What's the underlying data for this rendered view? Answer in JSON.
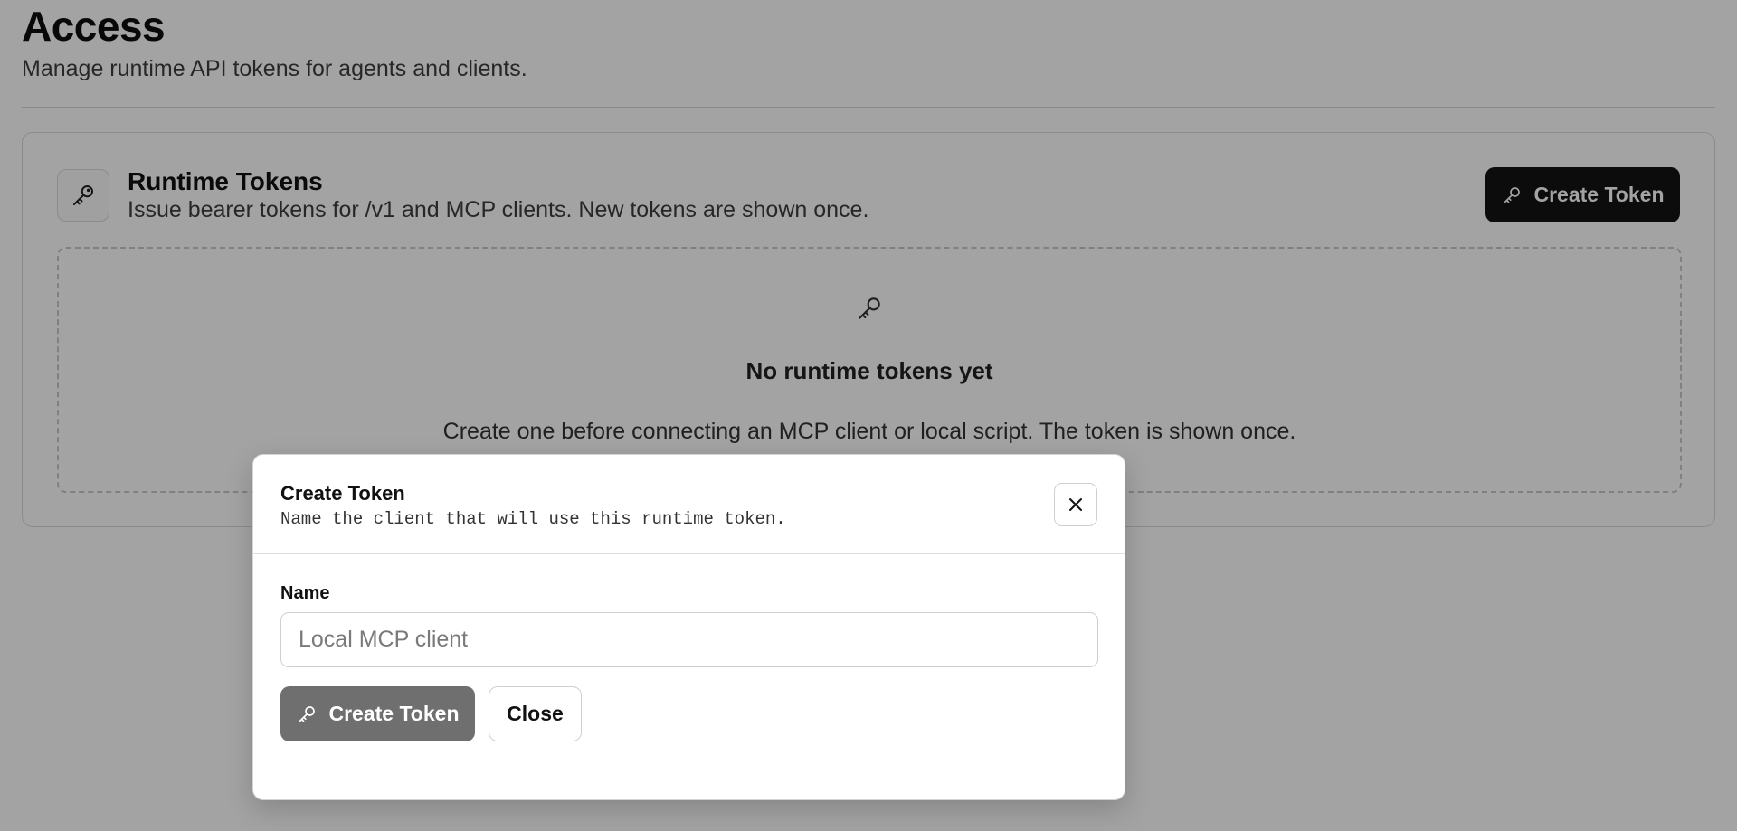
{
  "header": {
    "title": "Access",
    "subtitle": "Manage runtime API tokens for agents and clients."
  },
  "tokens_card": {
    "icon": "key-icon",
    "title": "Runtime Tokens",
    "description": "Issue bearer tokens for /v1 and MCP clients. New tokens are shown once.",
    "create_button_label": "Create Token",
    "create_button_icon": "key-icon"
  },
  "empty_state": {
    "icon": "key-icon",
    "title": "No runtime tokens yet",
    "description": "Create one before connecting an MCP client or local script. The token is shown once."
  },
  "modal": {
    "title": "Create Token",
    "description": "Name the client that will use this runtime token.",
    "close_icon": "close-icon",
    "name_label": "Name",
    "name_value": "",
    "name_placeholder": "Local MCP client",
    "submit_label": "Create Token",
    "submit_icon": "key-icon",
    "close_label": "Close"
  },
  "colors": {
    "primary_button": "#141414",
    "disabled_button": "#6f6f6f",
    "overlay": "rgba(0,0,0,0.36)"
  }
}
